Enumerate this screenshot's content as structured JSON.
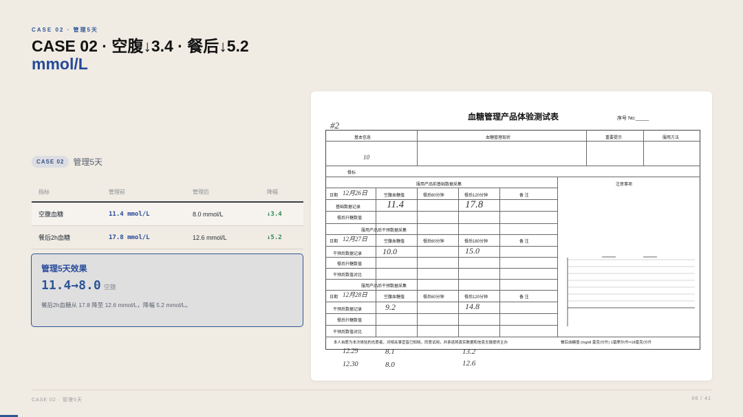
{
  "header": {
    "eyebrow": "CASE 02 · 管理5天",
    "title": "CASE 02 · 空腹↓3.4 · 餐后↓5.2",
    "title_unit": "mmol/L"
  },
  "case_badge": {
    "badge": "CASE 02",
    "text": "管理5天"
  },
  "table": {
    "columns": [
      "指标",
      "管理前",
      "管理后",
      "降幅"
    ],
    "rows": [
      {
        "metric": "空腹血糖",
        "before": "11.4 mmol/L",
        "after": "8.0 mmol/L",
        "drop": "↓3.4"
      },
      {
        "metric": "餐后2h血糖",
        "before": "17.8 mmol/L",
        "after": "12.6 mmol/L",
        "drop": "↓5.2"
      }
    ]
  },
  "effect": {
    "heading": "管理5天效果",
    "big": "11.4→8.0",
    "big_sub": "空腹",
    "desc": "餐后2h血糖从 17.8 降至 12.6 mmol/L，降幅 5.2 mmol/L。"
  },
  "form": {
    "title": "血糖管理产品体验测试表",
    "serial": "序号 No:_____",
    "mark": "#2",
    "sections": {
      "basic": "基本信息",
      "status": "血糖管理现状",
      "tips": "重要提示",
      "method": "服用方法",
      "baseline": "服用产品前基础数据采集",
      "notes": "注意事项",
      "collect1": "服用产品后干预数据采集",
      "collect2": "服用产品后干预数据采集",
      "breakfast": "餐标"
    },
    "labels": {
      "date": "日期",
      "fasting": "空腹血糖值",
      "post60": "餐后60分钟",
      "post120": "餐后120分钟",
      "post180": "餐后180分钟",
      "remark": "备 注",
      "base_record": "基础数据记录",
      "intervene_record": "干预后数据记录",
      "rise": "餐后升糖数值",
      "compare": "干预后数值对比",
      "unit_note": "餐后血糖值 (mg/dl 毫克/分升) 1毫摩尔/升=18毫克/分升",
      "promise": "本人自愿为本次体验的志愿者，对相关事宜皆已知晓，同意试用，并承诺将真实数据和信息无偿提供主办"
    },
    "handwritten": {
      "dates": [
        "12月26日",
        "12月27日",
        "12月28日"
      ],
      "row1": [
        "11.4",
        "17.8"
      ],
      "row2": [
        "10.0",
        "15.0"
      ],
      "row3": [
        "9.2",
        "14.8"
      ],
      "extra_dates": [
        "12.29",
        "12.30"
      ],
      "extra_fasting": [
        "8.1",
        "8.0"
      ],
      "extra_post": [
        "13.2",
        "12.6"
      ],
      "years": "10"
    }
  },
  "footer": {
    "left": "CASE 02 · 管理5天",
    "page": "06 / 41"
  },
  "colors": {
    "accent": "#2d5596",
    "drop": "#2f8a55",
    "bg": "#f0ebe3"
  }
}
